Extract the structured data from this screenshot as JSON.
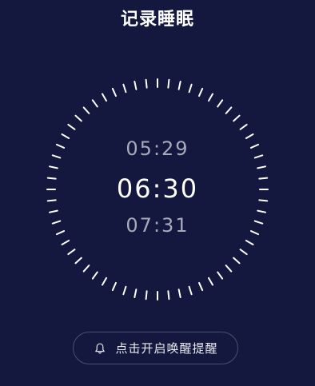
{
  "header": {
    "title": "记录睡眠"
  },
  "time_picker": {
    "previous_time": "05:29",
    "selected_time": "06:30",
    "next_time": "07:31"
  },
  "reminder_button": {
    "label": "点击开启唤醒提醒",
    "icon": "bell-icon"
  },
  "colors": {
    "background": "#14183e",
    "text_primary": "#ffffff",
    "text_secondary": "#a7aab8",
    "button_border": "#4b4f6d"
  },
  "dial": {
    "tick_count": 60
  }
}
